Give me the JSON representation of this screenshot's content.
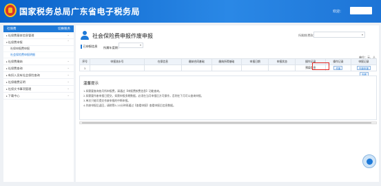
{
  "header": {
    "site_title": "国家税务总局广东省电子税务局",
    "welcome": "欢迎："
  },
  "sidebar": {
    "head_left": "社保费",
    "head_right": "切换税务",
    "sections": [
      {
        "label": "社保费基本信息管理",
        "subs": []
      },
      {
        "label": "社保费申报",
        "subs": [
          {
            "label": "社保申报费申报",
            "active": false
          },
          {
            "label": "社会保险费申报明细",
            "active": true
          }
        ]
      },
      {
        "label": "社保费缴纳",
        "subs": []
      },
      {
        "label": "社保费查询",
        "subs": []
      },
      {
        "label": "有扣入员有社会保险查询",
        "subs": []
      },
      {
        "label": "社保缴费证明",
        "subs": []
      },
      {
        "label": "社保文书事项管理",
        "subs": []
      },
      {
        "label": "下载中心",
        "subs": []
      }
    ]
  },
  "main": {
    "title": "社会保险费申报作废申报",
    "period_label": "所属期(费款期)：",
    "sub_tab": "已申报信息",
    "year_label": "所属年度期：",
    "unit": "单位：元、人",
    "table": {
      "headers": [
        "序号",
        "申报流水号",
        "在保信息",
        "缴纳合同基础",
        "缴纳所得基础",
        "申报日期",
        "申报状态",
        "操作记录",
        "操作记录",
        "申报记录"
      ],
      "row": [
        "1",
        "",
        "",
        "",
        "",
        "",
        "",
        "预填信息",
        "作废",
        "作废申报",
        "查看"
      ]
    },
    "tips": {
      "title": "温馨提示",
      "lines": [
        "1.如需要查询各月所申报费，请通过【申报费款费信息】功能查询。",
        "2.如需要作废申报已提交，如需申报多期数据，必须在当月申报后方可操作，否则在下月可以查询申报。",
        "3.单次只能可提交作废申报的中断申报。",
        "4.作废申报后返回，请稍等5-10分钟再通过【查看申报】查看申报后信息数据。"
      ]
    }
  }
}
